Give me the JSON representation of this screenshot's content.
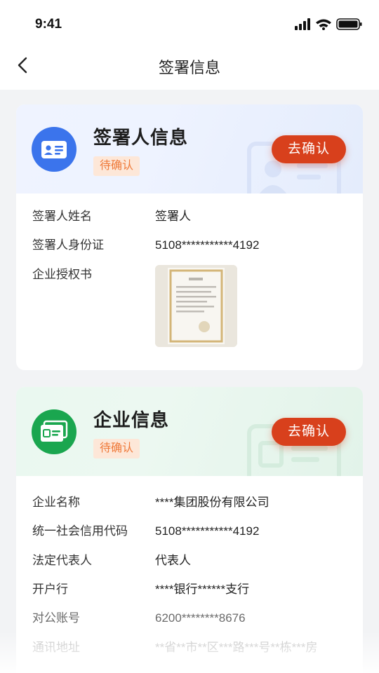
{
  "status_bar": {
    "time": "9:41"
  },
  "nav": {
    "title": "签署信息"
  },
  "signer_card": {
    "title": "签署人信息",
    "badge": "待确认",
    "confirm_label": "去确认",
    "rows": [
      {
        "label": "签署人姓名",
        "value": "签署人"
      },
      {
        "label": "签署人身份证",
        "value": "5108***********4192"
      },
      {
        "label": "企业授权书",
        "value": ""
      }
    ]
  },
  "company_card": {
    "title": "企业信息",
    "badge": "待确认",
    "confirm_label": "去确认",
    "rows": [
      {
        "label": "企业名称",
        "value": "****集团股份有限公司"
      },
      {
        "label": "统一社会信用代码",
        "value": "5108***********4192"
      },
      {
        "label": "法定代表人",
        "value": "代表人"
      },
      {
        "label": "开户行",
        "value": "****银行******支行"
      },
      {
        "label": "对公账号",
        "value": "6200********8676"
      },
      {
        "label": "通讯地址",
        "value": "**省**市**区***路***号**栋***房"
      }
    ]
  },
  "colors": {
    "accent_button": "#d8401c",
    "badge_text": "#ef7a3a",
    "badge_bg": "#fde7d8",
    "signer_icon": "#3b74ec",
    "company_icon": "#1aa64f"
  },
  "icons": {
    "back": "chevron-left-icon",
    "signal": "cellular-signal-icon",
    "wifi": "wifi-icon",
    "battery": "battery-icon",
    "signer": "id-card-icon",
    "company": "business-license-icon"
  }
}
